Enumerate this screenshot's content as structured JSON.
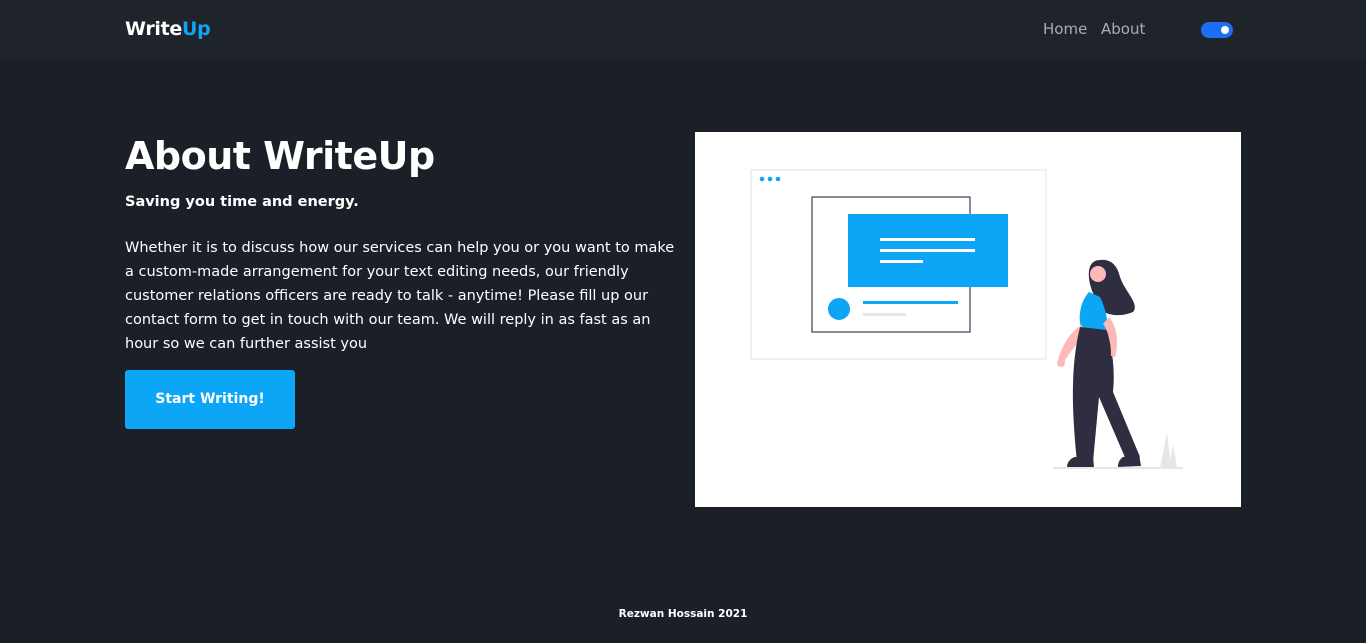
{
  "nav": {
    "brand_part1": "Write",
    "brand_part2": "Up",
    "links": [
      "Home",
      "About"
    ],
    "theme_toggle": "on"
  },
  "hero": {
    "title": "About WriteUp",
    "subtitle": "Saving you time and energy.",
    "body": "Whether it is to discuss how our services can help you or you want to make a custom-made arrangement for your text editing needs, our friendly customer relations officers are ready to talk - anytime! Please fill up our contact form to get in touch with our team. We will reply in as fast as an hour so we can further assist you",
    "cta_label": "Start Writing!"
  },
  "footer": {
    "text": "Rezwan Hossain 2021"
  },
  "colors": {
    "background": "#1b1f27",
    "navbar": "#1f232a",
    "accent": "#0da5f5",
    "toggle": "#1d6ef2"
  }
}
